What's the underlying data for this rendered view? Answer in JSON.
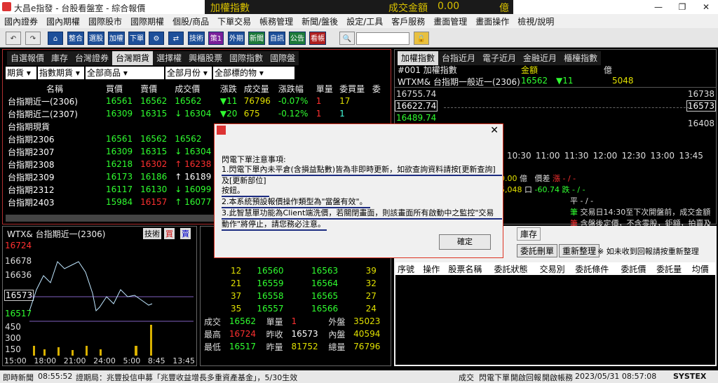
{
  "window": {
    "title": "大昌e指發 - 台股看盤室 - 綜合報價",
    "ticker_label": "加權指數",
    "ticker_value": "",
    "volume_label": "成交金額",
    "volume_value": "0.00",
    "volume_unit": "億"
  },
  "menu": [
    "國內證券",
    "國內期權",
    "國際股市",
    "國際期權",
    "個股/商品",
    "下單交易",
    "帳務管理",
    "新聞/盤後",
    "設定/工具",
    "客戶服務",
    "畫面管理",
    "畫面操作",
    "檢視/說明"
  ],
  "toolbar": {
    "buttons": [
      "整合",
      "選股",
      "加權",
      "下單",
      "技術",
      "策1",
      "外期",
      "新聞",
      "自訊",
      "公告",
      "看帳"
    ]
  },
  "quote_tabs": [
    "自選報價",
    "庫存",
    "台灣證券",
    "台灣期貨",
    "選擇權",
    "興櫃股票",
    "國際指數",
    "國際盤"
  ],
  "filters": [
    "期貨",
    "指數期貨",
    "全部商品",
    "全部月份",
    "全部標的物"
  ],
  "quote_headers": [
    "名稱",
    "買價",
    "賣價",
    "成交價",
    "漲跌",
    "成交量",
    "漲跌幅",
    "單量",
    "委買量",
    "委"
  ],
  "quote_rows": [
    {
      "name": "台指期近一(2306)",
      "bid": "16561",
      "ask": "16562",
      "last": "16562",
      "chg": "▼11",
      "vol": "76796",
      "pct": "-0.07%",
      "qty": "1",
      "bidq": "17"
    },
    {
      "name": "台指期近二(2307)",
      "bid": "16309",
      "ask": "16315",
      "last": "↓ 16304",
      "chg": "▼20",
      "vol": "675",
      "pct": "-0.12%",
      "qty": "1",
      "bidq": "1"
    },
    {
      "name": "台指期現貨",
      "bid": "",
      "ask": "",
      "last": "",
      "chg": "",
      "vol": "",
      "pct": "",
      "qty": "",
      "bidq": ""
    },
    {
      "name": "台指期2306",
      "bid": "16561",
      "ask": "16562",
      "last": "16562",
      "chg": "",
      "vol": "",
      "pct": "",
      "qty": "",
      "bidq": ""
    },
    {
      "name": "台指期2307",
      "bid": "16309",
      "ask": "16315",
      "last": "↓ 16304",
      "chg": "",
      "vol": "",
      "pct": "",
      "qty": "",
      "bidq": ""
    },
    {
      "name": "台指期2308",
      "bid": "16218",
      "ask": "16302",
      "last": "↑ 16238",
      "chg": "",
      "vol": "",
      "pct": "",
      "qty": "",
      "bidq": ""
    },
    {
      "name": "台指期2309",
      "bid": "16173",
      "ask": "16186",
      "last": "↑ 16189",
      "chg": "",
      "vol": "",
      "pct": "",
      "qty": "",
      "bidq": ""
    },
    {
      "name": "台指期2312",
      "bid": "16117",
      "ask": "16130",
      "last": "↓ 16099",
      "chg": "",
      "vol": "",
      "pct": "",
      "qty": "",
      "bidq": ""
    },
    {
      "name": "台指期2403",
      "bid": "15984",
      "ask": "16157",
      "last": "↑ 16077",
      "chg": "",
      "vol": "",
      "pct": "",
      "qty": "",
      "bidq": ""
    }
  ],
  "index_tabs": [
    "加權指數",
    "台指近月",
    "電子近月",
    "金融近月",
    "櫃檯指數"
  ],
  "index_info": {
    "line1": "#001 加權指數",
    "line2": "WTXM& 台指期一般近一(2306)",
    "val": "16562",
    "chg": "▼11",
    "amt_label": "金額",
    "amt": "5048",
    "unit": "億"
  },
  "index_axis": {
    "left": [
      "16755.74",
      "16622.74",
      "16489.74"
    ],
    "right": [
      "16738",
      "16573",
      "16408"
    ],
    "times": [
      "10:30",
      "11:00",
      "11:30",
      "12:00",
      "12:30",
      "13:00",
      "13:45"
    ]
  },
  "index_stats": {
    "r1a": "0.00",
    "r1b": "億",
    "r1c": "價差",
    "r1d": "漲",
    "r1e": "- / -",
    "r2a": "5,048",
    "r2b": "口",
    "r2c": "-60.74",
    "r2d": "跌",
    "r2e": "- / -",
    "r3": "平",
    "r3e": "- / -",
    "r4": "筆",
    "r4e": "交易日14:30至下次開盤前，成交金額",
    "r5": "筆",
    "r5e": "含盤後定價，不含零股，鉅額，拍賣及"
  },
  "chart": {
    "title": "WTX& 台指期近一(2306)",
    "btn1": "技術",
    "btn2": "買",
    "btn3": "賣",
    "y": [
      "16724",
      "16678",
      "16636",
      "16573",
      "16517",
      "450",
      "300",
      "150"
    ],
    "x": [
      "15:00",
      "18:00",
      "21:00",
      "24:00",
      "5:00",
      "8:45",
      "13:45"
    ]
  },
  "depth": {
    "rows": [
      [
        "12",
        "16560",
        "16563",
        "39"
      ],
      [
        "21",
        "16559",
        "16564",
        "32"
      ],
      [
        "37",
        "16558",
        "16565",
        "27"
      ],
      [
        "35",
        "16557",
        "16566",
        "24"
      ]
    ],
    "s1": [
      "成交",
      "16562",
      "單量",
      "1",
      "外盤",
      "35023"
    ],
    "s2": [
      "最高",
      "16724",
      "昨收",
      "16573",
      "內盤",
      "40594"
    ],
    "s3": [
      "最低",
      "16517",
      "昨量",
      "81752",
      "總量",
      "76796"
    ]
  },
  "orders": {
    "tab": "庫存",
    "btn1": "委託刪單",
    "btn2": "重新整理",
    "note": "※ 如未收到回報請按重新整理",
    "headers": [
      "序號",
      "操作",
      "股票名稱",
      "委託狀態",
      "交易別",
      "委託條件",
      "委託價",
      "委託量",
      "均價"
    ]
  },
  "dialog": {
    "heading": "閃電下單注意事項:",
    "l1": "1.閃電下單內未平倉(含損益點數)皆為非即時更新，如欲查詢資料請按[更新查詢]",
    "l2": "及[更新部位]按鈕。",
    "l3": "2.本系統預設報價操作類型為\"當盤有效\"。",
    "l4": "3.此智慧單功能為Client端洗價，若關閉畫面，則該畫面所有啟動中之監控\"交易",
    "l5": "動作\"將停止，請您務必注意。",
    "ok": "確定"
  },
  "status": {
    "news": "即時新聞",
    "time1": "08:55:52",
    "msg": "證期局：兆豐投信申募「兆豐收益增長多重資產基金」，5/30生效",
    "s1": "成交",
    "s2": "閃電下單",
    "s3": "開啟回報",
    "s4": "開啟帳務",
    "datetime": "2023/05/31 08:57:08",
    "brand": "SYSTEX"
  }
}
